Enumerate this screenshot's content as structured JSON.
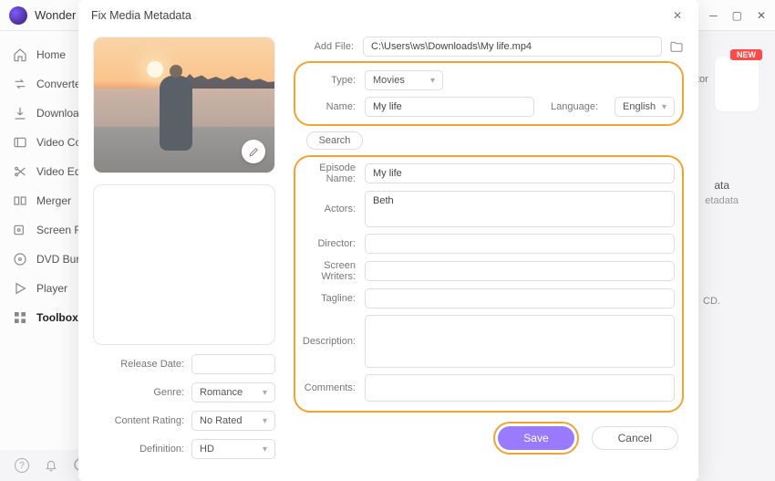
{
  "titlebar": {
    "app": "Wonder"
  },
  "sidebar": {
    "items": [
      {
        "label": "Home"
      },
      {
        "label": "Converter"
      },
      {
        "label": "Downloader"
      },
      {
        "label": "Video Compressor"
      },
      {
        "label": "Video Editor"
      },
      {
        "label": "Merger"
      },
      {
        "label": "Screen Recorder"
      },
      {
        "label": "DVD Burner"
      },
      {
        "label": "Player"
      },
      {
        "label": "Toolbox"
      }
    ]
  },
  "bg": {
    "new_badge": "NEW",
    "feature_title_tail": "tor",
    "meta_tail": "ata",
    "meta_desc_tail": "etadata",
    "cd_tail": "CD."
  },
  "modal": {
    "title": "Fix Media Metadata",
    "add_file_label": "Add File:",
    "add_file_value": "C:\\Users\\ws\\Downloads\\My life.mp4",
    "type_label": "Type:",
    "type_value": "Movies",
    "name_label": "Name:",
    "name_value": "My life",
    "language_label": "Language:",
    "language_value": "English",
    "search": "Search",
    "episode_label": "Episode Name:",
    "episode_value": "My life",
    "actors_label": "Actors:",
    "actors_value": "Beth",
    "director_label": "Director:",
    "writers_label": "Screen Writers:",
    "tagline_label": "Tagline:",
    "description_label": "Description:",
    "comments_label": "Comments:",
    "release_label": "Release Date:",
    "genre_label": "Genre:",
    "genre_value": "Romance",
    "rating_label": "Content Rating:",
    "rating_value": "No Rated",
    "definition_label": "Definition:",
    "definition_value": "HD",
    "save": "Save",
    "cancel": "Cancel"
  }
}
